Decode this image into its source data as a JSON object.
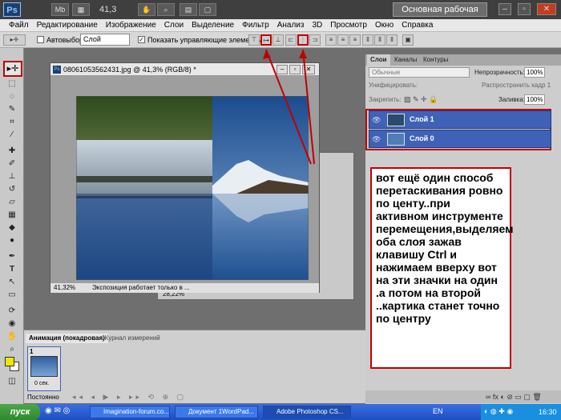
{
  "titlebar": {
    "logo": "Ps",
    "br": "Br",
    "mb": "Mb",
    "zoom": "41,3",
    "workspace": "Основная рабочая среда"
  },
  "menu": [
    "Файл",
    "Редактирование",
    "Изображение",
    "Слои",
    "Выделение",
    "Фильтр",
    "Анализ",
    "3D",
    "Просмотр",
    "Окно",
    "Справка"
  ],
  "options": {
    "autoselect": "Автовыбор:",
    "layer_select": "Слой",
    "show_controls": "Показать управляющие элементы"
  },
  "document": {
    "title": "08061053562431.jpg @ 41,3% (RGB/8) *",
    "zoom": "41,32%",
    "status": "Экспозиция работает только в ...",
    "behind_zoom": "28,22%"
  },
  "panels": {
    "tabs": [
      "Слои",
      "Каналы",
      "Контуры"
    ],
    "blend_mode": "Обычные",
    "opacity_label": "Непрозрачность:",
    "opacity": "100%",
    "unify_label": "Унифицировать:",
    "propagate": "Распространить кадр 1",
    "lock_label": "Закрепить:",
    "fill_label": "Заливка:",
    "fill": "100%",
    "layers": [
      "Слой 1",
      "Слой 0"
    ]
  },
  "note": "вот ещё один способ перетаскивания ровно по центу..при активном инструменте перемещения,выделяем оба слоя зажав клавишу Ctrl и нажимаем вверху вот на эти значки на один .а потом на второй ..картика станет точно по центру",
  "animation": {
    "tab_active": "Анимация (покадровая)",
    "tab_other": "Журнал измерений",
    "frame_number": "1",
    "frame_time": "0 сек.",
    "loop": "Постоянно"
  },
  "taskbar": {
    "start": "пуск",
    "items": [
      "Imagination-forum.co...",
      "Документ 1WordPad...",
      "Adobe Photoshop CS..."
    ],
    "lang": "EN",
    "clock": "16:30"
  },
  "colors": {
    "accent_red": "#c00000",
    "layer_selected": "#3f62b8",
    "foreground_swatch": "#e8e800"
  }
}
